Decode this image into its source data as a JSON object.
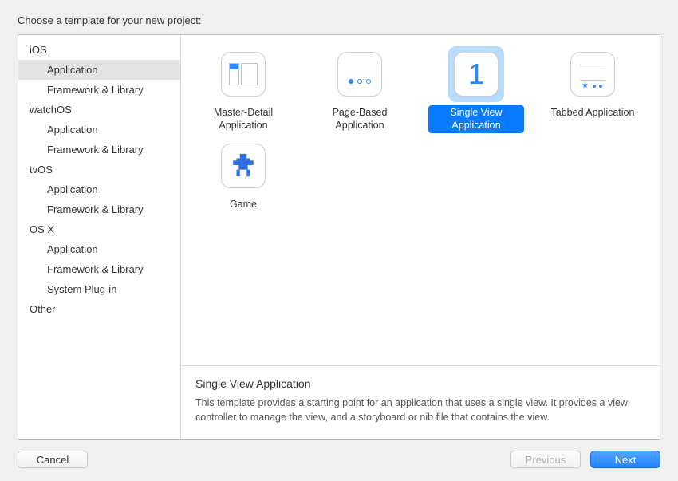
{
  "title": "Choose a template for your new project:",
  "sidebar": {
    "groups": [
      {
        "category": "iOS",
        "items": [
          {
            "label": "Application",
            "selected": true
          },
          {
            "label": "Framework & Library",
            "selected": false
          }
        ]
      },
      {
        "category": "watchOS",
        "items": [
          {
            "label": "Application",
            "selected": false
          },
          {
            "label": "Framework & Library",
            "selected": false
          }
        ]
      },
      {
        "category": "tvOS",
        "items": [
          {
            "label": "Application",
            "selected": false
          },
          {
            "label": "Framework & Library",
            "selected": false
          }
        ]
      },
      {
        "category": "OS X",
        "items": [
          {
            "label": "Application",
            "selected": false
          },
          {
            "label": "Framework & Library",
            "selected": false
          },
          {
            "label": "System Plug-in",
            "selected": false
          }
        ]
      },
      {
        "category": "Other",
        "items": []
      }
    ]
  },
  "templates": [
    {
      "label": "Master-Detail Application",
      "icon": "master-detail-icon",
      "selected": false
    },
    {
      "label": "Page-Based Application",
      "icon": "page-based-icon",
      "selected": false
    },
    {
      "label": "Single View Application",
      "icon": "single-view-icon",
      "selected": true
    },
    {
      "label": "Tabbed Application",
      "icon": "tabbed-icon",
      "selected": false
    },
    {
      "label": "Game",
      "icon": "game-icon",
      "selected": false
    }
  ],
  "description": {
    "title": "Single View Application",
    "body": "This template provides a starting point for an application that uses a single view. It provides a view controller to manage the view, and a storyboard or nib file that contains the view."
  },
  "buttons": {
    "cancel": "Cancel",
    "previous": "Previous",
    "next": "Next"
  }
}
